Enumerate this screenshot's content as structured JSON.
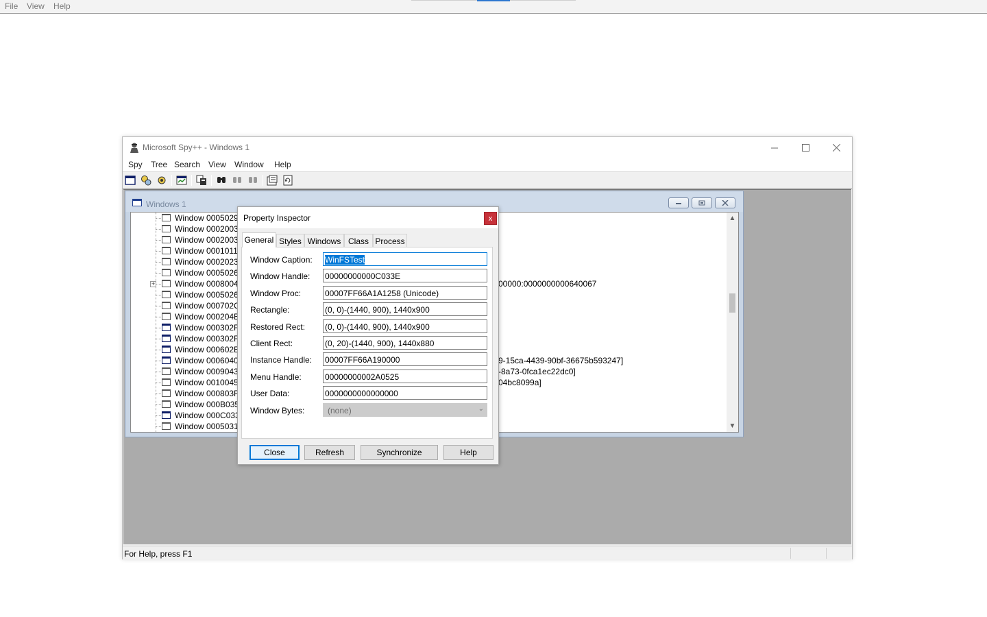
{
  "top_menu": {
    "items": [
      "File",
      "View",
      "Help"
    ]
  },
  "window": {
    "title": "Microsoft Spy++ - Windows 1",
    "menu": [
      "Spy",
      "Tree",
      "Search",
      "View",
      "Window",
      "Help"
    ],
    "toolbar_icons": [
      "windows-icon",
      "processes-icon",
      "threads-icon",
      "messages-icon",
      "log-messages-icon",
      "find-window-icon",
      "find-next-icon",
      "find-prev-icon",
      "properties-icon",
      "refresh-icon"
    ]
  },
  "child_window": {
    "title": "Windows 1",
    "tree": [
      {
        "label": "Window 0005029A",
        "icon": "light",
        "expander": false
      },
      {
        "label": "Window 00020032",
        "icon": "light",
        "expander": false
      },
      {
        "label": "Window 00020034",
        "icon": "light",
        "expander": false
      },
      {
        "label": "Window 00010112",
        "icon": "light",
        "expander": false
      },
      {
        "label": "Window 00020236",
        "icon": "light",
        "expander": false
      },
      {
        "label": "Window 0005026C",
        "icon": "light",
        "expander": false
      },
      {
        "label": "Window 0008004E",
        "icon": "light",
        "expander": true
      },
      {
        "label": "Window 00050264",
        "icon": "light",
        "expander": false
      },
      {
        "label": "Window 000702C0",
        "icon": "light",
        "expander": false
      },
      {
        "label": "Window 000204B6",
        "icon": "light",
        "expander": false
      },
      {
        "label": "Window 000302F8",
        "icon": "dark",
        "expander": false
      },
      {
        "label": "Window 000302F0",
        "icon": "dark",
        "expander": false
      },
      {
        "label": "Window 000602EE",
        "icon": "dark",
        "expander": false
      },
      {
        "label": "Window 0006040C",
        "icon": "dark",
        "expander": false
      },
      {
        "label": "Window 00090436",
        "icon": "light",
        "expander": false
      },
      {
        "label": "Window 0010045A",
        "icon": "light",
        "expander": false
      },
      {
        "label": "Window 000803F8",
        "icon": "light",
        "expander": false
      },
      {
        "label": "Window 000B0350",
        "icon": "light",
        "expander": false
      },
      {
        "label": "Window 000C033E",
        "icon": "dark",
        "expander": false
      },
      {
        "label": "Window 00050310",
        "icon": "light",
        "expander": false
      }
    ],
    "background_text": [
      "00000:0000000000640067",
      "9-15ca-4439-90bf-36675b593247]",
      "-8a73-0fca1ec22dc0]",
      "04bc8099a]"
    ]
  },
  "status_bar": {
    "text": "For Help, press F1"
  },
  "dialog": {
    "title": "Property Inspector",
    "close_glyph": "x",
    "tabs": [
      "General",
      "Styles",
      "Windows",
      "Class",
      "Process"
    ],
    "active_tab": "General",
    "fields": [
      {
        "label": "Window Caption:",
        "value": "WinFSTest"
      },
      {
        "label": "Window Handle:",
        "value": "00000000000C033E"
      },
      {
        "label": "Window Proc:",
        "value": "00007FF66A1A1258 (Unicode)"
      },
      {
        "label": "Rectangle:",
        "value": "(0, 0)-(1440, 900), 1440x900"
      },
      {
        "label": "Restored Rect:",
        "value": "(0, 0)-(1440, 900), 1440x900"
      },
      {
        "label": "Client Rect:",
        "value": "(0, 20)-(1440, 900), 1440x880"
      },
      {
        "label": "Instance Handle:",
        "value": "00007FF66A190000"
      },
      {
        "label": "Menu Handle:",
        "value": "00000000002A0525"
      },
      {
        "label": "User Data:",
        "value": "0000000000000000"
      }
    ],
    "window_bytes": {
      "label": "Window Bytes:",
      "value": "(none)"
    },
    "buttons": [
      "Close",
      "Refresh",
      "Synchronize",
      "Help"
    ]
  }
}
